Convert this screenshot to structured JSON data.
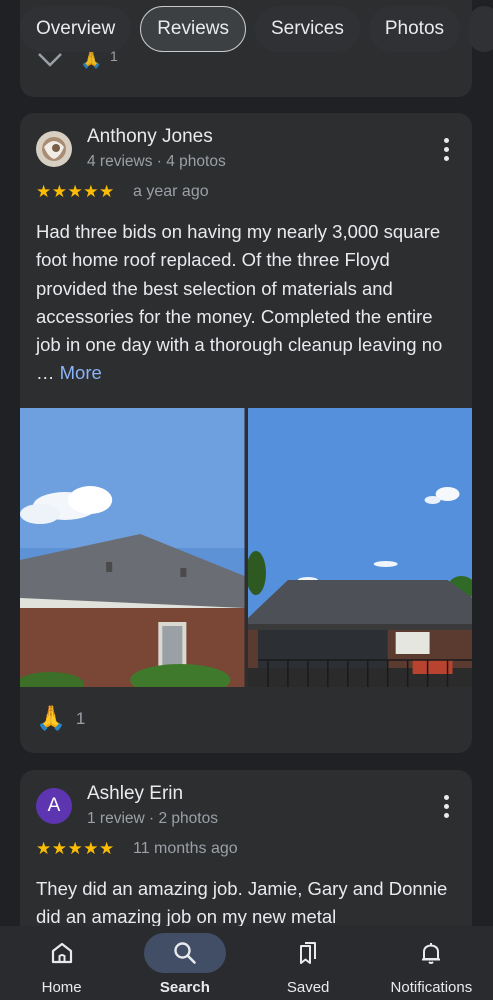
{
  "tabs": [
    "Overview",
    "Reviews",
    "Services",
    "Photos"
  ],
  "active_tab": "Reviews",
  "reviews": [
    {
      "name": "Anthony Jones",
      "meta": "4 reviews · 4 photos",
      "stars": "★★★★★",
      "rating": 5,
      "when": "a year ago",
      "text": "Had three bids on having my nearly 3,000 square foot home roof replaced. Of the three Floyd provided the best selection of materials and accessories for the money. Completed the entire job in one day with a thorough cleanup leaving no … ",
      "more": "More",
      "reaction_icon": "🙏",
      "reaction_count": "1"
    },
    {
      "name": "Ashley Erin",
      "avatar_letter": "A",
      "meta": "1 review · 2 photos",
      "stars": "★★★★★",
      "rating": 5,
      "when": "11 months ago",
      "text": "They did an amazing job. Jamie, Gary and Donnie did an amazing job on my new metal"
    }
  ],
  "previous_card": {
    "reaction_icon": "🙏",
    "reaction_count": "1"
  },
  "nav": [
    {
      "label": "Home",
      "icon": "home-icon"
    },
    {
      "label": "Search",
      "icon": "search-icon",
      "active": true
    },
    {
      "label": "Saved",
      "icon": "saved-icon"
    },
    {
      "label": "Notifications",
      "icon": "bell-icon"
    }
  ],
  "colors": {
    "background": "#202124",
    "card": "#2d2e30",
    "star": "#fbbc04",
    "link": "#8ab4f8",
    "avatar_purple": "#5e35b1"
  }
}
